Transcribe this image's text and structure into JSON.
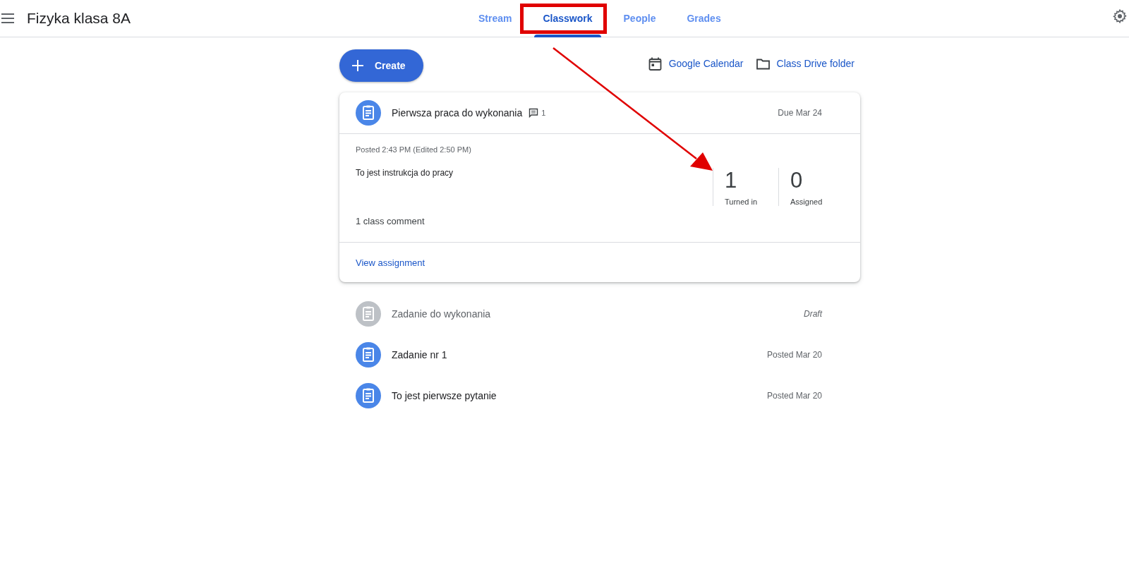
{
  "header": {
    "title": "Fizyka klasa 8A"
  },
  "tabs": [
    {
      "label": "Stream",
      "selected": false
    },
    {
      "label": "Classwork",
      "selected": true
    },
    {
      "label": "People",
      "selected": false
    },
    {
      "label": "Grades",
      "selected": false
    }
  ],
  "toolbar": {
    "create_button": "Create",
    "links": [
      "Google Calendar",
      "Class Drive folder"
    ]
  },
  "items": [
    {
      "title": "Pierwsza praca do wykonania",
      "comment_count": "1",
      "date": "Due Mar 24",
      "draft": false,
      "expanded": true,
      "details": {
        "posted": "Posted 2:43 PM (Edited 2:50 PM)",
        "instructions": "To jest instrukcja do pracy",
        "stats": [
          {
            "number": "1",
            "label": "Turned in"
          },
          {
            "number": "0",
            "label": "Assigned"
          }
        ],
        "comments": "1 class comment",
        "view_link": "View assignment"
      }
    },
    {
      "title": "Zadanie do wykonania",
      "date": "Draft",
      "draft": true,
      "expanded": false
    },
    {
      "title": "Zadanie nr 1",
      "date": "Posted Mar 20",
      "draft": false,
      "expanded": false
    },
    {
      "title": "To jest pierwsze pytanie",
      "date": "Posted Mar 20",
      "draft": false,
      "expanded": false
    }
  ],
  "annotations": {
    "highlight_box": true,
    "arrow": true
  }
}
